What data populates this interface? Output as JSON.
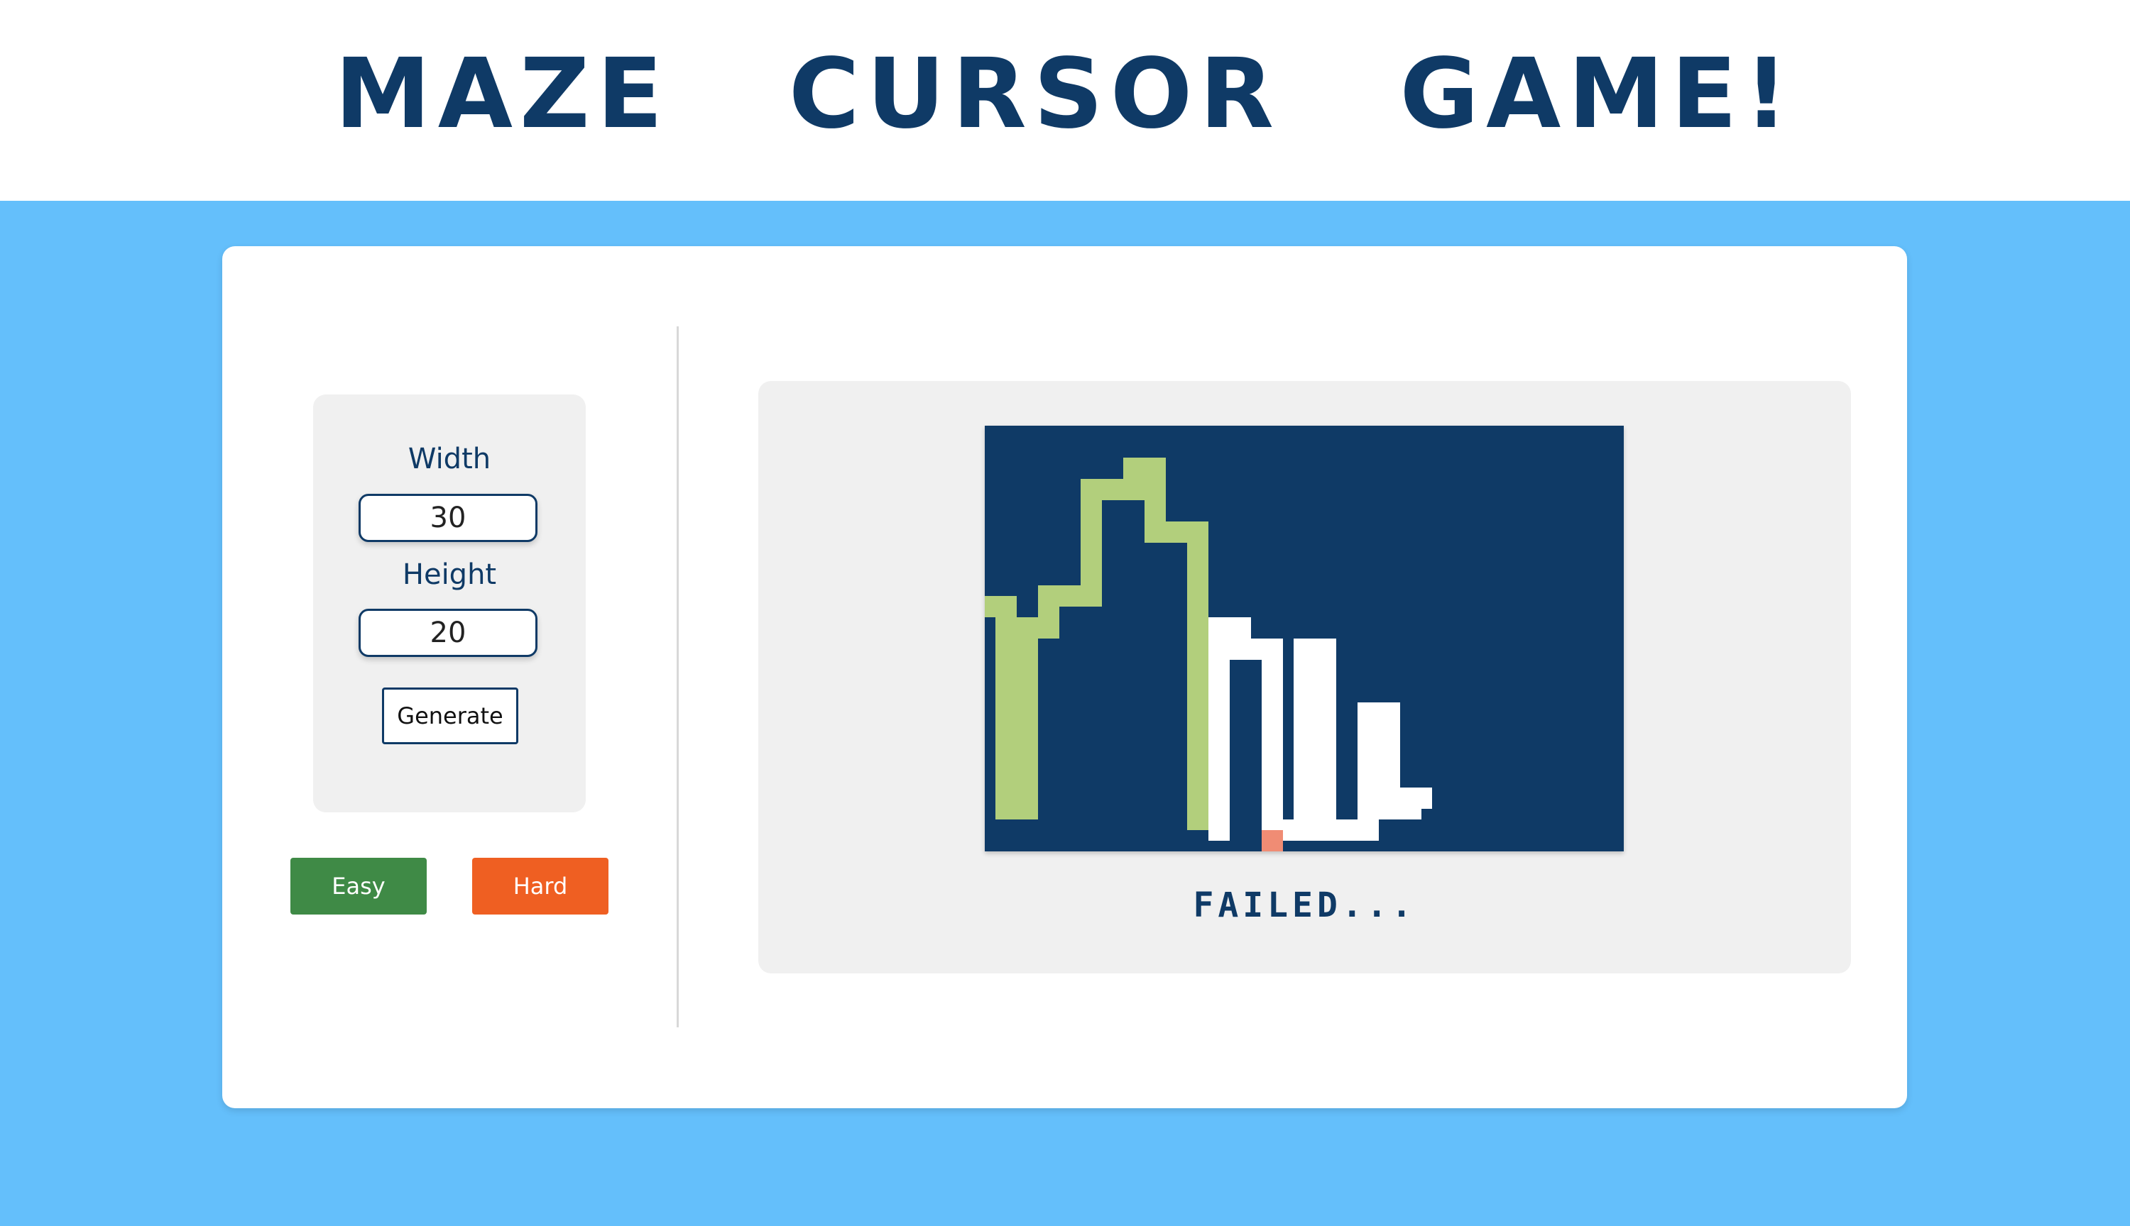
{
  "header": {
    "title": "MAZE CURSOR GAME!"
  },
  "settings": {
    "width_label": "Width",
    "width_value": "30",
    "height_label": "Height",
    "height_value": "20",
    "generate_label": "Generate"
  },
  "modes": {
    "easy_label": "Easy",
    "hard_label": "Hard"
  },
  "game": {
    "status": "FAILED...",
    "grid": {
      "columns": 30,
      "rows": 20
    },
    "colors": {
      "background": "#0f3a66",
      "traced_path": "#b2cf7c",
      "remaining_path": "#ffffff",
      "fail_cell": "#f08c74"
    }
  },
  "colors": {
    "page_background": "#64bffb",
    "title": "#0f3a66",
    "easy_button": "#3f8a46",
    "hard_button": "#ef5f22"
  }
}
